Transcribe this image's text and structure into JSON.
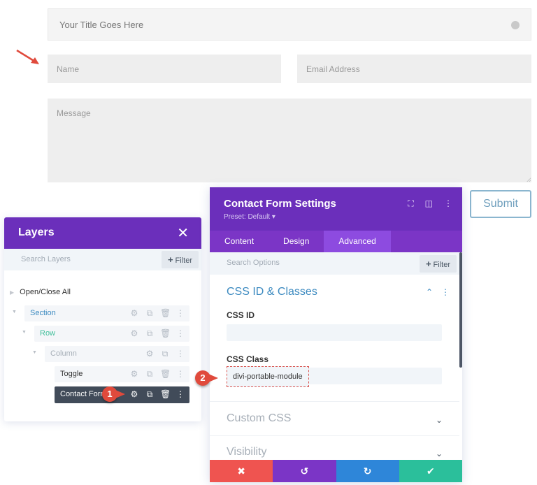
{
  "form": {
    "title_placeholder": "Your Title Goes Here",
    "name_placeholder": "Name",
    "email_placeholder": "Email Address",
    "message_placeholder": "Message",
    "submit_label": "Submit"
  },
  "layers": {
    "title": "Layers",
    "close_icon": "✕",
    "search_placeholder": "Search Layers",
    "filter_label": "Filter",
    "open_close_all": "Open/Close All",
    "items": [
      {
        "label": "Section",
        "color": "#3c8ac0"
      },
      {
        "label": "Row",
        "color": "#3fbf9a"
      },
      {
        "label": "Column",
        "color": "#a6aeb7"
      },
      {
        "label": "Toggle",
        "color": "#333333"
      },
      {
        "label": "Contact Form",
        "color": "#ffffff",
        "selected": true
      }
    ]
  },
  "callouts": {
    "one": "1",
    "two": "2"
  },
  "settings": {
    "title": "Contact Form Settings",
    "preset": "Preset: Default ▾",
    "tabs": [
      {
        "label": "Content",
        "active": false
      },
      {
        "label": "Design",
        "active": false
      },
      {
        "label": "Advanced",
        "active": true
      }
    ],
    "search_placeholder": "Search Options",
    "filter_label": "Filter",
    "group_title": "CSS ID & Classes",
    "css_id_label": "CSS ID",
    "css_id_value": "",
    "css_class_label": "CSS Class",
    "css_class_value": "divi-portable-module",
    "sections": [
      "Custom CSS",
      "Visibility"
    ],
    "footer": {
      "cancel_icon": "✖",
      "undo_icon": "↺",
      "redo_icon": "↻",
      "save_icon": "✔"
    }
  },
  "colors": {
    "purple": "#6b2fbb",
    "tab_active": "#8d4be0",
    "cancel": "#ef5450",
    "redo": "#2e86d9",
    "save": "#2bbf9b",
    "callout": "#e04a3c"
  }
}
